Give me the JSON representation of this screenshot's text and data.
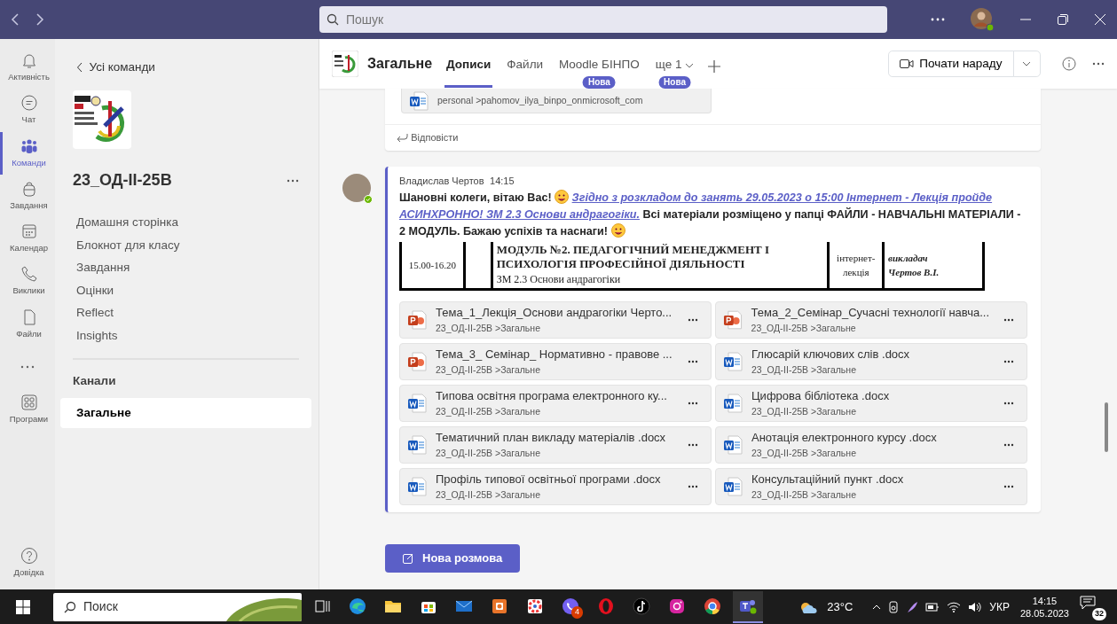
{
  "title_bar": {
    "search": {
      "placeholder": "Пошук"
    }
  },
  "rail": [
    {
      "kind": "bell",
      "label": "Активність",
      "selected": false
    },
    {
      "kind": "chat",
      "label": "Чат",
      "selected": false
    },
    {
      "kind": "teams",
      "label": "Команди",
      "selected": true
    },
    {
      "kind": "bag",
      "label": "Завдання",
      "selected": false
    },
    {
      "kind": "calendar",
      "label": "Календар",
      "selected": false
    },
    {
      "kind": "phone",
      "label": "Виклики",
      "selected": false
    },
    {
      "kind": "file",
      "label": "Файли",
      "selected": false
    },
    {
      "kind": "more"
    },
    {
      "kind": "apps",
      "label": "Програми",
      "selected": false
    }
  ],
  "rail_help": {
    "label": "Довідка"
  },
  "sidebar": {
    "back": "Усі команди",
    "team_name": "23_ОД-ІІ-25В",
    "items": [
      "Домашня сторінка",
      "Блокнот для класу",
      "Завдання",
      "Оцінки",
      "Reflect",
      "Insights"
    ],
    "channels_heading": "Канали",
    "channels": [
      {
        "label": "Загальне",
        "selected": true
      }
    ]
  },
  "header": {
    "channel": "Загальне",
    "tabs": [
      {
        "label": "Дописи",
        "selected": true
      },
      {
        "label": "Файли",
        "selected": false
      },
      {
        "label": "Moodle БІНПО",
        "selected": false,
        "badge": "Нова"
      },
      {
        "label": "ще 1",
        "selected": false,
        "badge": "Нова",
        "dropdown": true
      }
    ],
    "meet_button": "Почати нараду"
  },
  "previous_post": {
    "attachment": {
      "kind": "word",
      "path": "personal >pahomov_ilya_binpo_onmicrosoft_com"
    },
    "reply": "Відповісти"
  },
  "post": {
    "author": "Владислав Чертов",
    "time": "14:15",
    "online": true,
    "message": [
      {
        "kind": "text",
        "text": "Шановні колеги, вітаю Вас!"
      },
      {
        "kind": "emoji"
      },
      {
        "kind": "link",
        "text": "Згідно з розкладом до занять 29.05.2023 о 15:00 Інтернет - Лекція пройде"
      },
      {
        "kind": "link",
        "text": "АСИНХРОННО! ЗМ 2.3 Основи андрагогіки."
      },
      {
        "kind": "text",
        "text": "Всі матеріали розміщено у папці ФАЙЛИ - НАВЧАЛЬНІ МАТЕРІАЛИ - 2 МОДУЛЬ. Бажаю успіхів та наснаги!"
      },
      {
        "kind": "emoji"
      }
    ],
    "document_excerpt": {
      "time": "15.00-16.20",
      "title": "МОДУЛЬ №2. ПЕДАГОГІЧНИЙ МЕНЕДЖМЕНТ І ПСИХОЛОГІЯ ПРОФЕСІЙНОЇ ДІЯЛЬНОСТІ",
      "subtitle": "ЗМ 2.3 Основи андрагогіки",
      "format": "інтернет-лекція",
      "teacher_role": "викладач",
      "teacher": "Чертов В.І."
    },
    "files": [
      {
        "kind": "ppt",
        "name": "Тема_1_Лекція_Основи андрагогіки Черто...",
        "path": "23_ОД-ІІ-25В >Загальне"
      },
      {
        "kind": "ppt",
        "name": "Тема_2_Семінар_Сучасні технології навча...",
        "path": "23_ОД-ІІ-25В >Загальне"
      },
      {
        "kind": "ppt",
        "name": "Тема_3_ Семінар_ Нормативно - правове ...",
        "path": "23_ОД-ІІ-25В >Загальне"
      },
      {
        "kind": "word",
        "name": "Глюсарій ключових слів .docx",
        "path": "23_ОД-ІІ-25В >Загальне"
      },
      {
        "kind": "word",
        "name": "Типова освітня програма електронного ку...",
        "path": "23_ОД-ІІ-25В >Загальне"
      },
      {
        "kind": "word",
        "name": "Цифрова бібліотека .docx",
        "path": "23_ОД-ІІ-25В >Загальне"
      },
      {
        "kind": "word",
        "name": "Тематичний план викладу матеріалів .docx",
        "path": "23_ОД-ІІ-25В >Загальне"
      },
      {
        "kind": "word",
        "name": "Анотація електронного курсу .docx",
        "path": "23_ОД-ІІ-25В >Загальне"
      },
      {
        "kind": "word",
        "name": "Профіль типової освітньої програми .docx",
        "path": "23_ОД-ІІ-25В >Загальне"
      },
      {
        "kind": "word",
        "name": "Консультаційний пункт .docx",
        "path": "23_ОД-ІІ-25В >Загальне"
      }
    ]
  },
  "new_conversation": "Нова розмова",
  "taskbar": {
    "search": "Поиск",
    "apps": [
      {
        "kind": "taskview"
      },
      {
        "kind": "edge"
      },
      {
        "kind": "folder"
      },
      {
        "kind": "store"
      },
      {
        "kind": "mail"
      },
      {
        "kind": "orange"
      },
      {
        "kind": "flower"
      },
      {
        "kind": "viber",
        "badge": "4"
      },
      {
        "kind": "opera"
      },
      {
        "kind": "tiktok"
      },
      {
        "kind": "instagram"
      },
      {
        "kind": "chrome"
      },
      {
        "kind": "teams",
        "active": true
      }
    ],
    "weather": "23°C",
    "language": "УКР",
    "time": "14:15",
    "date": "28.05.2023",
    "notifications": "32"
  }
}
